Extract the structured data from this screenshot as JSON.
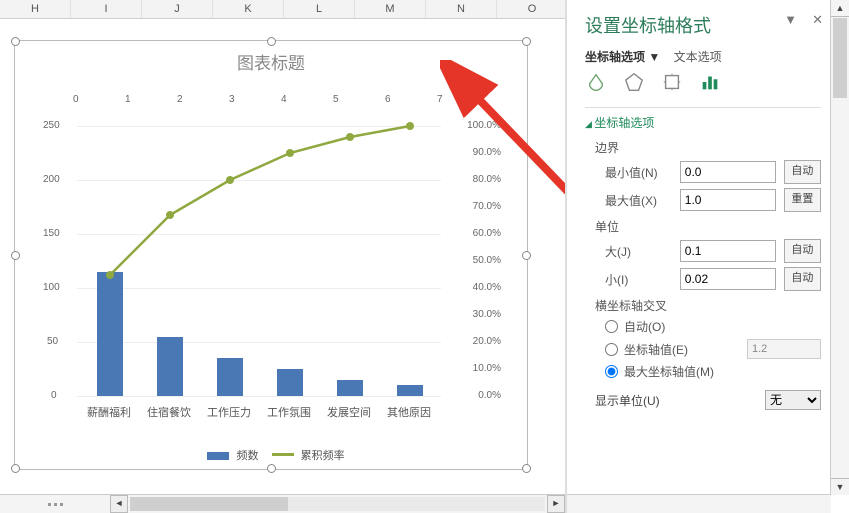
{
  "columns": [
    "H",
    "I",
    "J",
    "K",
    "L",
    "M",
    "N",
    "O"
  ],
  "chart": {
    "title": "图表标题",
    "legend": {
      "freq": "频数",
      "cum": "累积频率"
    }
  },
  "chart_data": {
    "type": "bar+line",
    "categories": [
      "薪酬福利",
      "住宿餐饮",
      "工作压力",
      "工作氛围",
      "发展空间",
      "其他原因"
    ],
    "bars": {
      "name": "频数",
      "values": [
        115,
        55,
        35,
        25,
        15,
        10
      ],
      "color": "#4a78b5"
    },
    "line": {
      "name": "累积频率",
      "values": [
        0.45,
        0.67,
        0.8,
        0.9,
        0.96,
        1.0
      ],
      "color": "#8fa83f"
    },
    "y1": {
      "min": 0,
      "max": 250,
      "step": 50,
      "ticks": [
        0,
        50,
        100,
        150,
        200,
        250
      ]
    },
    "y2": {
      "min": 0,
      "max": 1.0,
      "step": 0.1,
      "ticks": [
        "0.0%",
        "10.0%",
        "20.0%",
        "30.0%",
        "40.0%",
        "50.0%",
        "60.0%",
        "70.0%",
        "80.0%",
        "90.0%",
        "100.0%"
      ]
    },
    "x2": {
      "ticks": [
        0,
        1,
        2,
        3,
        4,
        5,
        6,
        7
      ]
    }
  },
  "pane": {
    "title": "设置坐标轴格式",
    "tab_axis": "坐标轴选项",
    "tab_text": "文本选项",
    "section_axis": "坐标轴选项",
    "bounds": "边界",
    "min_label": "最小值(N)",
    "min_value": "0.0",
    "auto": "自动",
    "max_label": "最大值(X)",
    "max_value": "1.0",
    "reset": "重置",
    "unit": "单位",
    "major_label": "大(J)",
    "major_value": "0.1",
    "minor_label": "小(I)",
    "minor_value": "0.02",
    "cross": "横坐标轴交叉",
    "cross_auto": "自动(O)",
    "cross_at": "坐标轴值(E)",
    "cross_at_value": "1.2",
    "cross_max": "最大坐标轴值(M)",
    "disp_unit": "显示单位(U)",
    "disp_unit_value": "无"
  }
}
